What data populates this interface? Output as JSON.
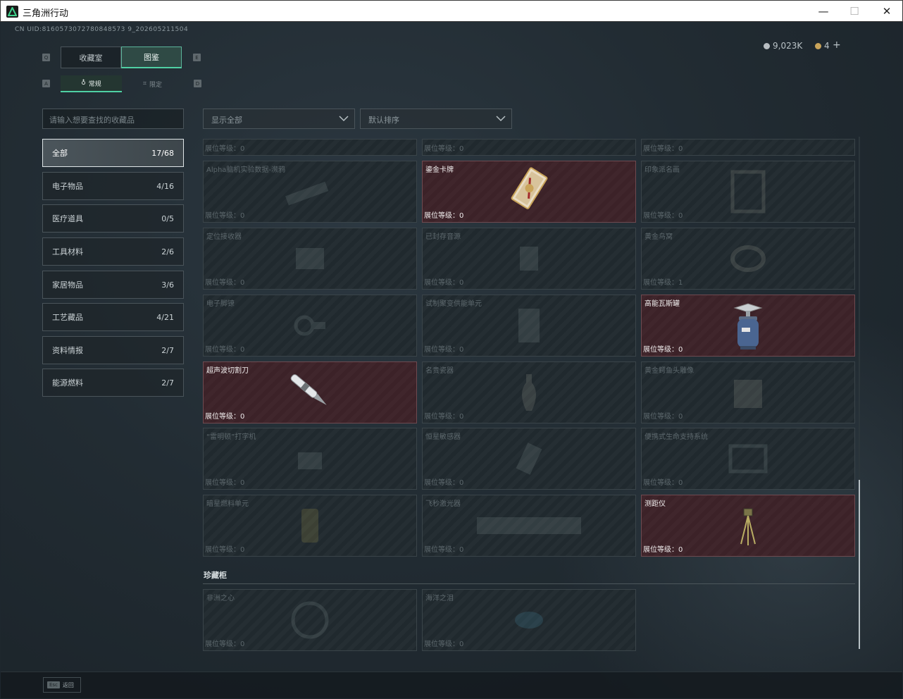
{
  "window": {
    "title": "三角洲行动",
    "minimize": "—",
    "maximize": "☐",
    "close": "✕"
  },
  "header": {
    "uid": "CN UID:8160573072780848573 9_202605211504"
  },
  "currency": {
    "balance": "9,023K",
    "tokens": "4",
    "add": "+"
  },
  "tabs": [
    {
      "label": "收藏室",
      "active": false
    },
    {
      "label": "图鉴",
      "active": true
    }
  ],
  "subtabs": [
    {
      "label": "常规",
      "active": true
    },
    {
      "label": "限定",
      "active": false
    }
  ],
  "keyhints": {
    "tab_left": "Q",
    "tab_right": "E",
    "sub_left": "A",
    "sub_right": "D"
  },
  "search": {
    "placeholder": "请输入想要查找的收藏品"
  },
  "filters": {
    "show": "显示全部",
    "sort": "默认排序"
  },
  "categories": [
    {
      "label": "全部",
      "count": "17/68",
      "active": true
    },
    {
      "label": "电子物品",
      "count": "4/16"
    },
    {
      "label": "医疗道具",
      "count": "0/5"
    },
    {
      "label": "工具材料",
      "count": "2/6"
    },
    {
      "label": "家居物品",
      "count": "3/6"
    },
    {
      "label": "工艺藏品",
      "count": "4/21"
    },
    {
      "label": "资料情报",
      "count": "2/7"
    },
    {
      "label": "能源燃料",
      "count": "2/7"
    }
  ],
  "level_prefix": "展位等级：",
  "items": [
    {
      "name": "",
      "level": "展位等级：0",
      "owned": false,
      "icon": "partial-item-icon"
    },
    {
      "name": "",
      "level": "展位等级：0",
      "owned": false,
      "icon": "partial-item-icon"
    },
    {
      "name": "",
      "level": "展位等级：0",
      "owned": false,
      "icon": "partial-item-icon"
    },
    {
      "name": "Alpha脑机实验数据-濒鸦",
      "level": "展位等级：0",
      "owned": false,
      "icon": "data-drive-icon"
    },
    {
      "name": "鎏金卡牌",
      "level": "展位等级：0",
      "owned": true,
      "icon": "gilded-card-icon"
    },
    {
      "name": "印象派名画",
      "level": "展位等级：0",
      "owned": false,
      "icon": "painting-icon"
    },
    {
      "name": "定位接收器",
      "level": "展位等级：0",
      "owned": false,
      "icon": "receiver-icon"
    },
    {
      "name": "已封存音源",
      "level": "展位等级：0",
      "owned": false,
      "icon": "audio-icon"
    },
    {
      "name": "黄金鸟窝",
      "level": "展位等级：1",
      "owned": false,
      "icon": "nest-icon"
    },
    {
      "name": "电子脚镣",
      "level": "展位等级：0",
      "owned": false,
      "icon": "shackle-icon"
    },
    {
      "name": "试制聚变供能单元",
      "level": "展位等级：0",
      "owned": false,
      "icon": "fusion-unit-icon"
    },
    {
      "name": "高能瓦斯罐",
      "level": "展位等级：0",
      "owned": true,
      "icon": "gas-canister-icon"
    },
    {
      "name": "超声波切割刀",
      "level": "展位等级：0",
      "owned": true,
      "icon": "ultrasonic-cutter-icon"
    },
    {
      "name": "名贵瓷器",
      "level": "展位等级：0",
      "owned": false,
      "icon": "vase-icon"
    },
    {
      "name": "黄金鳄鱼头雕像",
      "level": "展位等级：0",
      "owned": false,
      "icon": "crocodile-statue-icon"
    },
    {
      "name": "“雷明顿”打字机",
      "level": "展位等级：0",
      "owned": false,
      "icon": "typewriter-icon"
    },
    {
      "name": "恒星敏感器",
      "level": "展位等级：0",
      "owned": false,
      "icon": "star-sensor-icon"
    },
    {
      "name": "便携式生命支持系统",
      "level": "展位等级：0",
      "owned": false,
      "icon": "life-support-icon"
    },
    {
      "name": "暗星燃料单元",
      "level": "展位等级：0",
      "owned": false,
      "icon": "fuel-cell-icon"
    },
    {
      "name": "飞秒激光器",
      "level": "展位等级：0",
      "owned": false,
      "icon": "laser-icon"
    },
    {
      "name": "测距仪",
      "level": "展位等级：0",
      "owned": true,
      "icon": "rangefinder-icon"
    }
  ],
  "cabinet": {
    "title": "珍藏柜",
    "items": [
      {
        "name": "非洲之心",
        "level": "展位等级：0",
        "owned": false,
        "icon": "gem-icon"
      },
      {
        "name": "海洋之泪",
        "level": "展位等级：0",
        "owned": false,
        "icon": "gem-icon"
      }
    ]
  },
  "footer": {
    "esc_key": "Esc",
    "esc_label": "返回"
  },
  "colors": {
    "accent": "#4fd0a4",
    "owned_bg": "#3c2228",
    "owned_border": "#6e4a50",
    "locked_bg": "#20292e"
  }
}
